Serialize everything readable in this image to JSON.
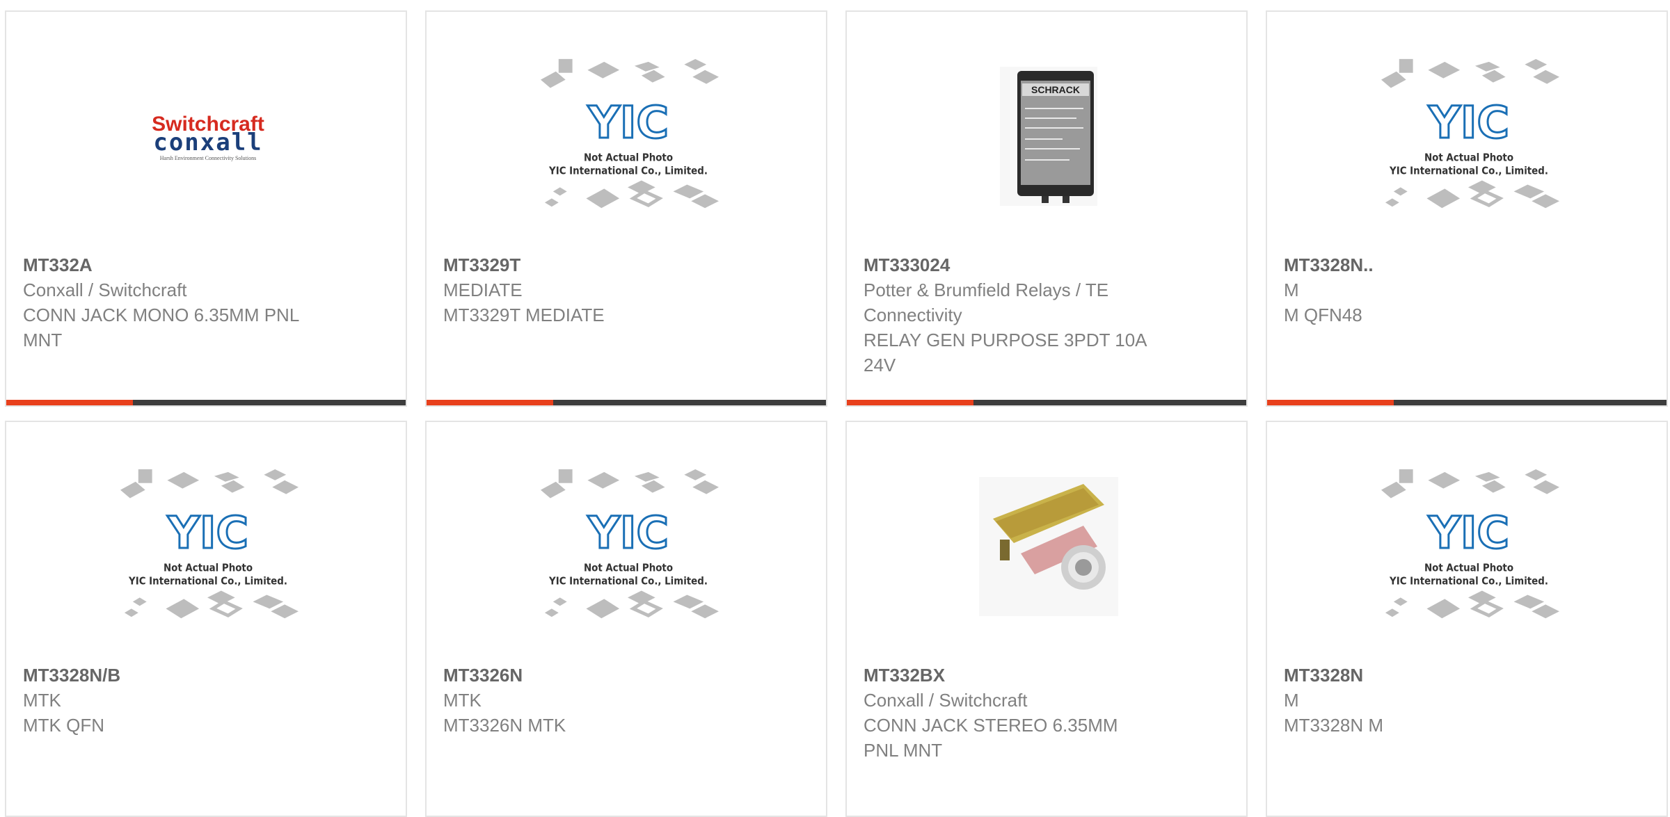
{
  "cards": [
    {
      "part": "MT332A",
      "mfr": "Conxall / Switchcraft",
      "desc": "CONN JACK MONO 6.35MM PNL MNT",
      "image": "switchcraft-logo"
    },
    {
      "part": "MT3329T",
      "mfr": "MEDIATE",
      "desc": "MT3329T MEDIATE",
      "image": "yic-placeholder"
    },
    {
      "part": "MT333024",
      "mfr": "Potter & Brumfield Relays / TE Connectivity",
      "desc": "RELAY GEN PURPOSE 3PDT 10A 24V",
      "image": "relay-photo"
    },
    {
      "part": "MT3328N..",
      "mfr": "M",
      "desc": "M QFN48",
      "image": "yic-placeholder"
    },
    {
      "part": "MT3328N/B",
      "mfr": "MTK",
      "desc": "MTK QFN",
      "image": "yic-placeholder"
    },
    {
      "part": "MT3326N",
      "mfr": "MTK",
      "desc": "MT3326N MTK",
      "image": "yic-placeholder"
    },
    {
      "part": "MT332BX",
      "mfr": "Conxall / Switchcraft",
      "desc": "CONN JACK STEREO 6.35MM PNL MNT",
      "image": "jack-photo"
    },
    {
      "part": "MT3328N",
      "mfr": "M",
      "desc": "MT3328N M",
      "image": "yic-placeholder"
    }
  ],
  "placeholder": {
    "line1": "Not Actual Photo",
    "line2": "YIC International Co., Limited.",
    "brand": "YIC"
  },
  "logo": {
    "top": "Switchcraft",
    "bottom": "conxall",
    "tagline": "Harsh Environment Connectivity Solutions"
  },
  "relay_label": "SCHRACK",
  "colors": {
    "accent": "#e8401c",
    "bar": "#3d3d3d",
    "border": "#e4e4e4",
    "yic_blue": "#1a6fb5",
    "logo_red": "#d62a1f",
    "logo_navy": "#1b3f7a"
  }
}
